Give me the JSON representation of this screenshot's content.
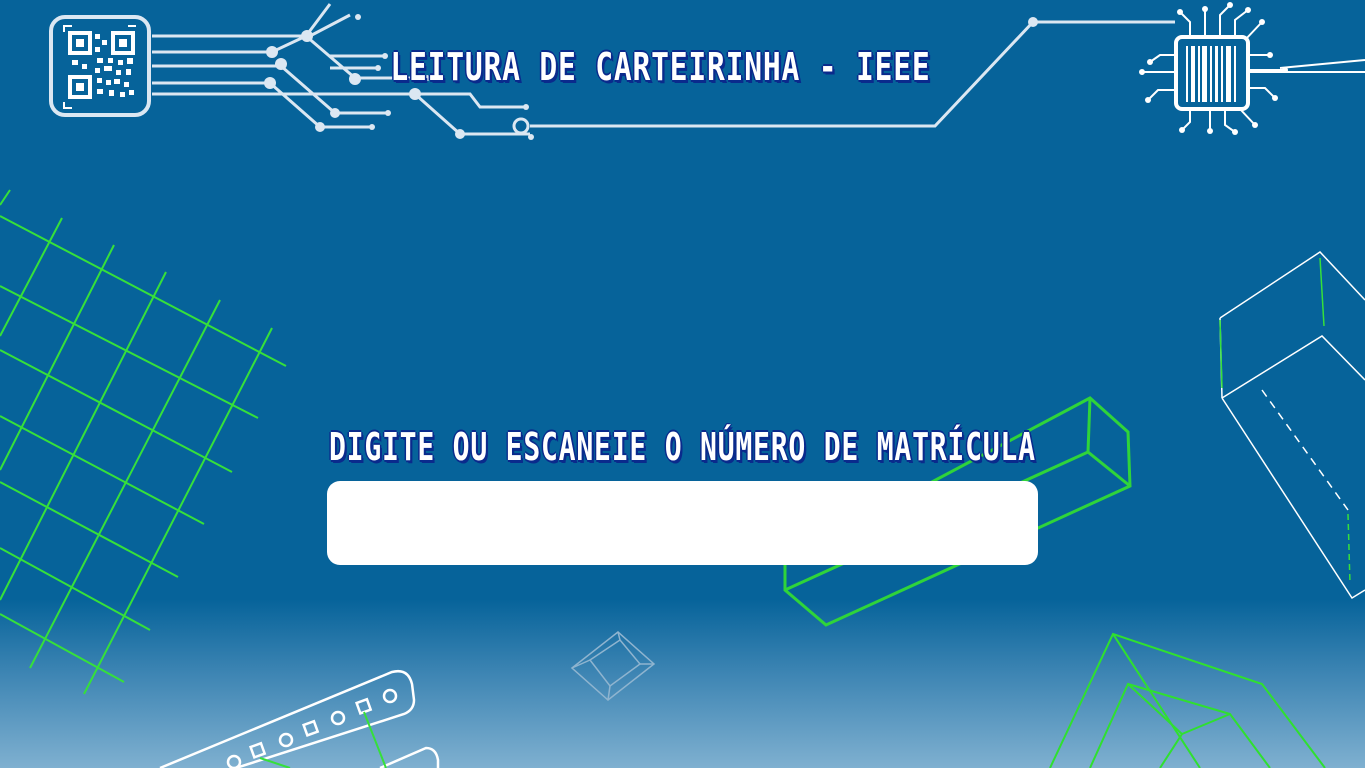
{
  "header": {
    "title": "LEITURA DE CARTEIRINHA - IEEE"
  },
  "main": {
    "prompt": "DIGITE OU ESCANEIE O NÚMERO DE MATRÍCULA",
    "input_value": "",
    "input_placeholder": ""
  },
  "icons": {
    "qr": "qr-code-icon",
    "chip": "barcode-chip-icon"
  },
  "colors": {
    "background": "#06639a",
    "accent_green": "#2fe02f",
    "title_outline": "#0a2a8c",
    "input_background": "#ffffff"
  }
}
